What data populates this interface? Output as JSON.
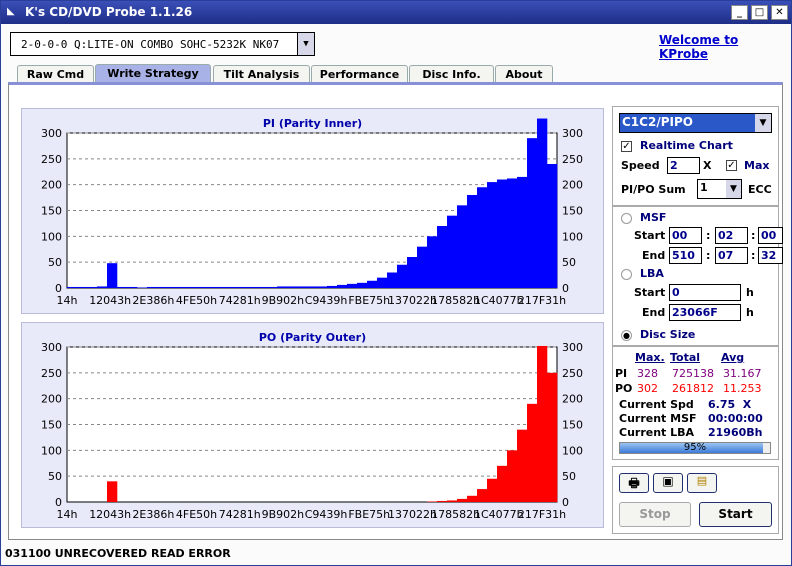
{
  "title": "K's CD/DVD Probe 1.1.26",
  "drive": "2-0-0-0 Q:LITE-ON COMBO SOHC-5232K NK07",
  "welcome": "Welcome to KProbe",
  "tabs": [
    "Raw Cmd",
    "Write Strategy",
    "Tilt Analysis",
    "Performance",
    "Disc Info.",
    "About"
  ],
  "active_tab": "Write Strategy",
  "charts": {
    "pi": {
      "title": "PI (Parity Inner)"
    },
    "po": {
      "title": "PO (Parity Outer)"
    }
  },
  "chart_data": [
    {
      "type": "bar",
      "title": "PI (Parity Inner)",
      "color": "#0000ff",
      "ylim": [
        0,
        300
      ],
      "yticks": [
        "0",
        "50",
        "100",
        "150",
        "200",
        "250",
        "300"
      ],
      "xticks": [
        "14h",
        "12043h",
        "2E386h",
        "4FE50h",
        "74281h",
        "9B902h",
        "C9439h",
        "FBE75h",
        "137022h",
        "178582h",
        "1C4077h",
        "217F31h"
      ],
      "values": [
        2,
        2,
        2,
        3,
        48,
        2,
        2,
        1,
        2,
        2,
        2,
        2,
        2,
        2,
        2,
        2,
        2,
        2,
        2,
        2,
        2,
        3,
        3,
        3,
        3,
        3,
        4,
        6,
        8,
        10,
        14,
        20,
        30,
        45,
        60,
        80,
        100,
        120,
        140,
        160,
        180,
        195,
        205,
        210,
        212,
        215,
        290,
        328,
        240
      ]
    },
    {
      "type": "bar",
      "title": "PO (Parity Outer)",
      "color": "#ff0000",
      "ylim": [
        0,
        300
      ],
      "yticks": [
        "0",
        "50",
        "100",
        "150",
        "200",
        "250",
        "300"
      ],
      "xticks": [
        "14h",
        "12043h",
        "2E386h",
        "4FE50h",
        "74281h",
        "9B902h",
        "C9439h",
        "FBE75h",
        "137022h",
        "178582h",
        "1C4077h",
        "217F31h"
      ],
      "values": [
        0,
        0,
        0,
        0,
        40,
        0,
        0,
        0,
        0,
        0,
        0,
        0,
        0,
        0,
        0,
        0,
        0,
        0,
        0,
        0,
        0,
        0,
        0,
        0,
        0,
        0,
        0,
        0,
        0,
        0,
        0,
        0,
        0,
        0,
        0,
        0,
        1,
        2,
        3,
        6,
        12,
        25,
        45,
        70,
        100,
        140,
        190,
        302,
        250
      ]
    }
  ],
  "side": {
    "mode": "C1C2/PIPO",
    "realtime": "Realtime Chart",
    "speed_label": "Speed",
    "speed": "2",
    "x": "X",
    "max": "Max",
    "sum_label": "PI/PO Sum",
    "sum": "1",
    "ecc": "ECC",
    "msf": "MSF",
    "start": "Start",
    "end": "End",
    "msf_start": [
      "00",
      "02",
      "00"
    ],
    "msf_end": [
      "510",
      "07",
      "32"
    ],
    "colon": ":",
    "lba": "LBA",
    "lba_start": "0",
    "lba_end": "23066F",
    "h": "h",
    "disc_size": "Disc Size",
    "hdr_max": "Max.",
    "hdr_total": "Total",
    "hdr_avg": "Avg",
    "pi_label": "PI",
    "pi_max": "328",
    "pi_total": "725138",
    "pi_avg": "31.167",
    "po_label": "PO",
    "po_max": "302",
    "po_total": "261812",
    "po_avg": "11.253",
    "cur_spd_label": "Current Spd",
    "cur_spd": "6.75  X",
    "cur_msf_label": "Current MSF",
    "cur_msf": "00:00:00",
    "cur_lba_label": "Current LBA",
    "cur_lba": "21960Bh",
    "progress": 95,
    "progress_text": "95%",
    "stop": "Stop",
    "start_btn": "Start"
  },
  "status": "031100 UNRECOVERED READ ERROR"
}
